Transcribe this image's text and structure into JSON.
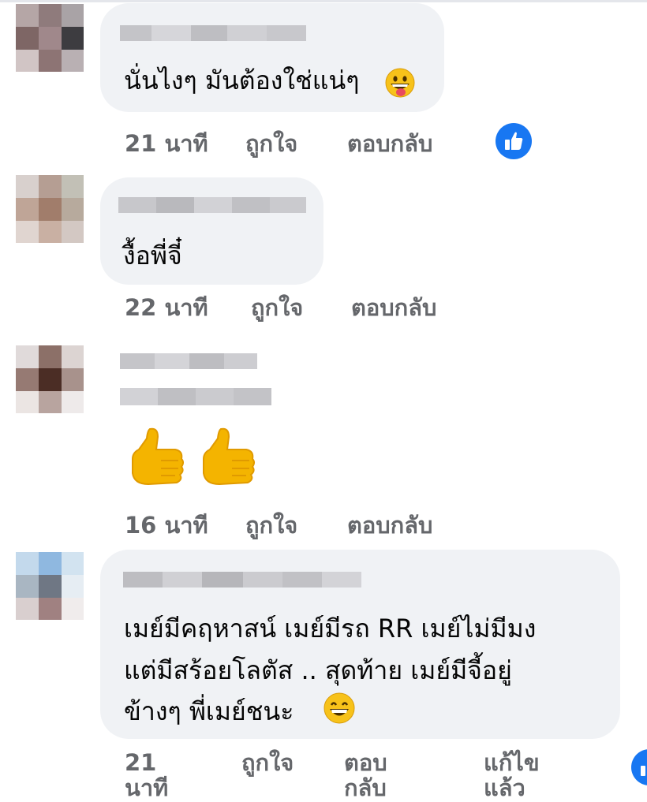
{
  "comments": [
    {
      "text": "นั่นไงๆ มันต้องใช่แน่ๆ",
      "emoji": "grinning-tongue-emoji",
      "time": "21 นาที",
      "like_label": "ถูกใจ",
      "reply_label": "ตอบกลับ",
      "reaction": "like"
    },
    {
      "text": "งื้อพี่จี๋",
      "time": "22 นาที",
      "like_label": "ถูกใจ",
      "reply_label": "ตอบกลับ"
    },
    {
      "emoji": "thumbs-up-emoji",
      "time": "16 นาที",
      "like_label": "ถูกใจ",
      "reply_label": "ตอบกลับ"
    },
    {
      "lines": [
        "เมย์มีคฤหาสน์ เมย์มีรถ RR เมย์ไม่มีมง",
        "แต่มีสร้อยโลตัส .. สุดท้าย เมย์มีจี้อยู่",
        "ข้างๆ พี่เมย์ชนะ"
      ],
      "emoji": "grinning-smile-emoji",
      "time_line1": "21",
      "time_line2": "นาที",
      "like_label": "ถูกใจ",
      "reply_line1": "ตอบ",
      "reply_line2": "กลับ",
      "edited_line1": "แก้ไข",
      "edited_line2": "แล้ว"
    }
  ],
  "colors": {
    "bubble": "#f0f2f5",
    "meta": "#65676b",
    "accent": "#1877f2",
    "text": "#050505"
  }
}
